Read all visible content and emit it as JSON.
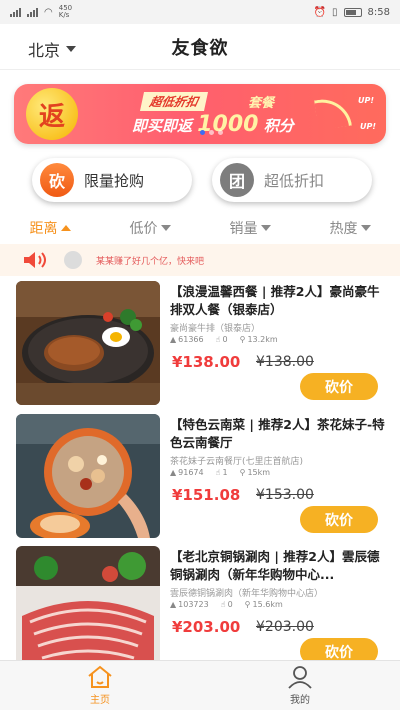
{
  "status_bar": {
    "net_speed": "450\nK/s",
    "time": "8:58"
  },
  "header": {
    "city": "北京",
    "title": "友食欲"
  },
  "banner": {
    "badge": "返",
    "tag": "超低折扣",
    "combo": "套餐",
    "line": "即买即返",
    "points": "1000",
    "points_unit": "积分",
    "up": "UP!"
  },
  "promos": [
    {
      "icon_char": "砍",
      "label": "限量抢购"
    },
    {
      "icon_char": "团",
      "label": "超低折扣"
    }
  ],
  "sort_tabs": [
    "距离",
    "低价",
    "销量",
    "热度"
  ],
  "notice": {
    "text": "某某赚了好几个亿，快来吧"
  },
  "listings": [
    {
      "title": "【浪漫温馨西餐 | 推荐2人】豪尚豪牛排双人餐（银泰店）",
      "shop": "豪尚豪牛排（银泰店）",
      "sales": "61366",
      "likes": "0",
      "distance": "13.2km",
      "price": "¥138.00",
      "original_price": "¥138.00",
      "button": "砍价"
    },
    {
      "title": "【特色云南菜 | 推荐2人】茶花妹子-特色云南餐厅",
      "shop": "茶花妹子云南餐厅(七里庄首航店)",
      "sales": "91674",
      "likes": "1",
      "distance": "15km",
      "price": "¥151.08",
      "original_price": "¥153.00",
      "button": "砍价"
    },
    {
      "title": "【老北京铜锅涮肉 | 推荐2人】雲辰德铜锅涮肉（新年华购物中心...",
      "shop": "雲辰德铜锅涮肉（新年华购物中心店）",
      "sales": "103723",
      "likes": "0",
      "distance": "15.6km",
      "price": "¥203.00",
      "original_price": "¥203.00",
      "button": "砍价"
    }
  ],
  "tabbar": {
    "home": "主页",
    "me": "我的"
  },
  "colors": {
    "accent": "#f6921e",
    "price": "#f03c3c",
    "button": "#f6b123"
  }
}
